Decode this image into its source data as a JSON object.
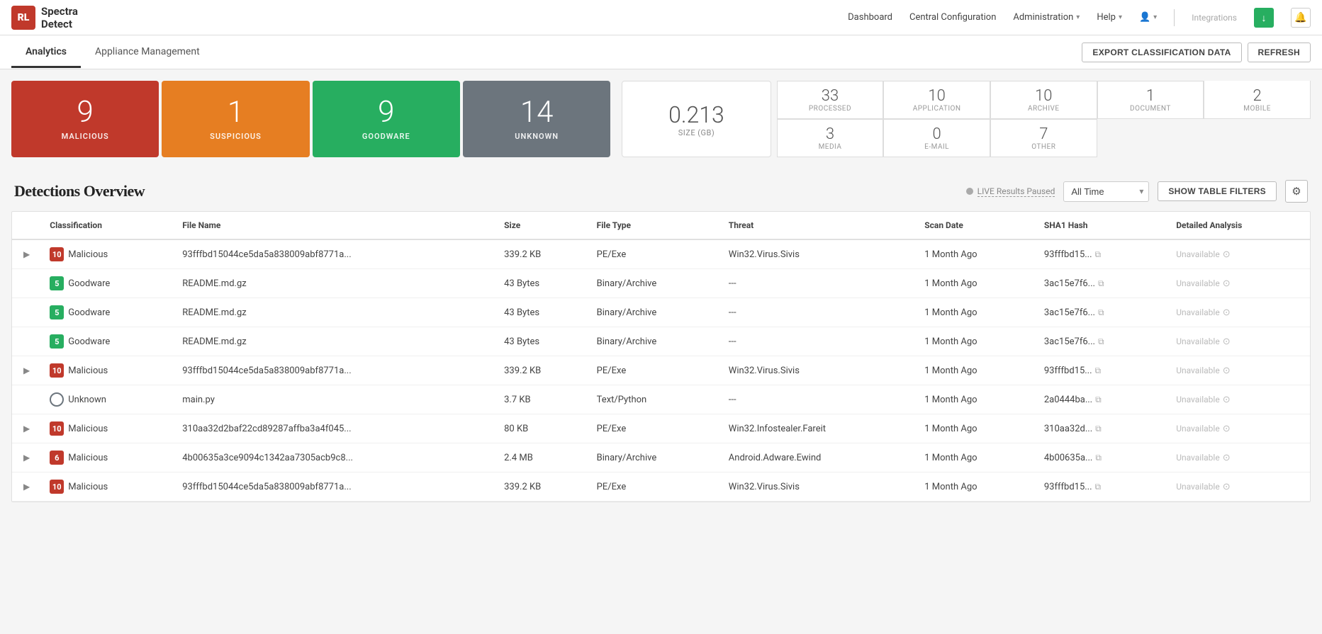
{
  "header": {
    "logo_initials": "RL",
    "logo_name": "Spectra\nDetect",
    "nav": {
      "dashboard": "Dashboard",
      "central_config": "Central Configuration",
      "administration": "Administration",
      "help": "Help",
      "user": "User",
      "integrations": "Integrations"
    }
  },
  "tabs": {
    "analytics": "Analytics",
    "appliance_management": "Appliance Management",
    "export_btn": "EXPORT CLASSIFICATION DATA",
    "refresh_btn": "REFRESH"
  },
  "stats": {
    "malicious": {
      "count": "9",
      "label": "MALICIOUS"
    },
    "suspicious": {
      "count": "1",
      "label": "SUSPICIOUS"
    },
    "goodware": {
      "count": "9",
      "label": "GOODWARE"
    },
    "unknown": {
      "count": "14",
      "label": "UNKNOWN"
    },
    "size": {
      "value": "0.213",
      "label": "SIZE (GB)"
    },
    "processed": {
      "count": "33",
      "label": "PROCESSED"
    },
    "application": {
      "count": "10",
      "label": "APPLICATION"
    },
    "archive": {
      "count": "10",
      "label": "ARCHIVE"
    },
    "document": {
      "count": "1",
      "label": "DOCUMENT"
    },
    "mobile": {
      "count": "2",
      "label": "MOBILE"
    },
    "media": {
      "count": "3",
      "label": "MEDIA"
    },
    "email": {
      "count": "0",
      "label": "E-MAIL"
    },
    "other": {
      "count": "7",
      "label": "OTHER"
    }
  },
  "detections": {
    "title": "Detections Overview",
    "live_text": "LIVE Results Paused",
    "time_filter": "All Time",
    "show_filters": "SHOW TABLE FILTERS",
    "columns": [
      "Classification",
      "File Name",
      "Size",
      "File Type",
      "Threat",
      "Scan Date",
      "SHA1 Hash",
      "Detailed Analysis"
    ],
    "rows": [
      {
        "expandable": true,
        "badge_type": "red",
        "badge_num": "10",
        "classification": "Malicious",
        "filename": "93fffbd15044ce5da5a838009abf8771a...",
        "size": "339.2 KB",
        "filetype": "PE/Exe",
        "threat": "Win32.Virus.Sivis",
        "scan_date": "1 Month Ago",
        "sha1": "93fffbd15...",
        "analysis": "Unavailable"
      },
      {
        "expandable": false,
        "badge_type": "green",
        "badge_num": "5",
        "classification": "Goodware",
        "filename": "README.md.gz",
        "size": "43 Bytes",
        "filetype": "Binary/Archive",
        "threat": "---",
        "scan_date": "1 Month Ago",
        "sha1": "3ac15e7f6...",
        "analysis": "Unavailable"
      },
      {
        "expandable": false,
        "badge_type": "green",
        "badge_num": "5",
        "classification": "Goodware",
        "filename": "README.md.gz",
        "size": "43 Bytes",
        "filetype": "Binary/Archive",
        "threat": "---",
        "scan_date": "1 Month Ago",
        "sha1": "3ac15e7f6...",
        "analysis": "Unavailable"
      },
      {
        "expandable": false,
        "badge_type": "green",
        "badge_num": "5",
        "classification": "Goodware",
        "filename": "README.md.gz",
        "size": "43 Bytes",
        "filetype": "Binary/Archive",
        "threat": "---",
        "scan_date": "1 Month Ago",
        "sha1": "3ac15e7f6...",
        "analysis": "Unavailable"
      },
      {
        "expandable": true,
        "badge_type": "red",
        "badge_num": "10",
        "classification": "Malicious",
        "filename": "93fffbd15044ce5da5a838009abf8771a...",
        "size": "339.2 KB",
        "filetype": "PE/Exe",
        "threat": "Win32.Virus.Sivis",
        "scan_date": "1 Month Ago",
        "sha1": "93fffbd15...",
        "analysis": "Unavailable"
      },
      {
        "expandable": false,
        "badge_type": "unknown",
        "badge_num": "",
        "classification": "Unknown",
        "filename": "main.py",
        "size": "3.7 KB",
        "filetype": "Text/Python",
        "threat": "---",
        "scan_date": "1 Month Ago",
        "sha1": "2a0444ba...",
        "analysis": "Unavailable"
      },
      {
        "expandable": true,
        "badge_type": "red",
        "badge_num": "10",
        "classification": "Malicious",
        "filename": "310aa32d2baf22cd89287affba3a4f045...",
        "size": "80 KB",
        "filetype": "PE/Exe",
        "threat": "Win32.Infostealer.Fareit",
        "scan_date": "1 Month Ago",
        "sha1": "310aa32d...",
        "analysis": "Unavailable"
      },
      {
        "expandable": true,
        "badge_type": "red",
        "badge_num": "6",
        "classification": "Malicious",
        "filename": "4b00635a3ce9094c1342aa7305acb9c8...",
        "size": "2.4 MB",
        "filetype": "Binary/Archive",
        "threat": "Android.Adware.Ewind",
        "scan_date": "1 Month Ago",
        "sha1": "4b00635a...",
        "analysis": "Unavailable"
      },
      {
        "expandable": true,
        "badge_type": "red",
        "badge_num": "10",
        "classification": "Malicious",
        "filename": "93fffbd15044ce5da5a838009abf8771a...",
        "size": "339.2 KB",
        "filetype": "PE/Exe",
        "threat": "Win32.Virus.Sivis",
        "scan_date": "1 Month Ago",
        "sha1": "93fffbd15...",
        "analysis": "Unavailable"
      }
    ]
  }
}
